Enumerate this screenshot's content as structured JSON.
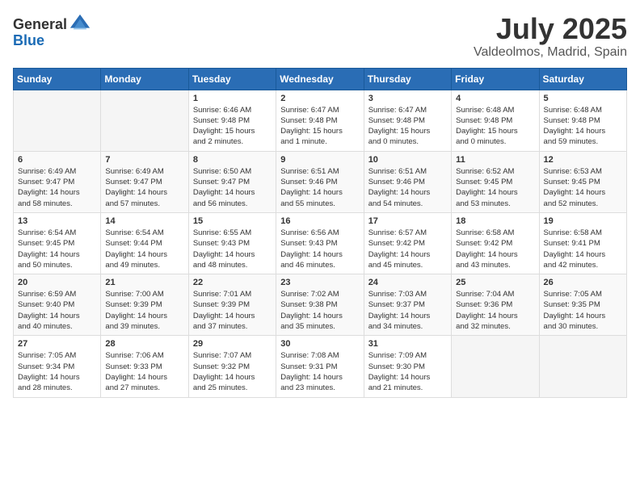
{
  "header": {
    "logo_general": "General",
    "logo_blue": "Blue",
    "month_year": "July 2025",
    "location": "Valdeolmos, Madrid, Spain"
  },
  "calendar": {
    "days_of_week": [
      "Sunday",
      "Monday",
      "Tuesday",
      "Wednesday",
      "Thursday",
      "Friday",
      "Saturday"
    ],
    "weeks": [
      [
        {
          "day": "",
          "info": ""
        },
        {
          "day": "",
          "info": ""
        },
        {
          "day": "1",
          "info": "Sunrise: 6:46 AM\nSunset: 9:48 PM\nDaylight: 15 hours\nand 2 minutes."
        },
        {
          "day": "2",
          "info": "Sunrise: 6:47 AM\nSunset: 9:48 PM\nDaylight: 15 hours\nand 1 minute."
        },
        {
          "day": "3",
          "info": "Sunrise: 6:47 AM\nSunset: 9:48 PM\nDaylight: 15 hours\nand 0 minutes."
        },
        {
          "day": "4",
          "info": "Sunrise: 6:48 AM\nSunset: 9:48 PM\nDaylight: 15 hours\nand 0 minutes."
        },
        {
          "day": "5",
          "info": "Sunrise: 6:48 AM\nSunset: 9:48 PM\nDaylight: 14 hours\nand 59 minutes."
        }
      ],
      [
        {
          "day": "6",
          "info": "Sunrise: 6:49 AM\nSunset: 9:47 PM\nDaylight: 14 hours\nand 58 minutes."
        },
        {
          "day": "7",
          "info": "Sunrise: 6:49 AM\nSunset: 9:47 PM\nDaylight: 14 hours\nand 57 minutes."
        },
        {
          "day": "8",
          "info": "Sunrise: 6:50 AM\nSunset: 9:47 PM\nDaylight: 14 hours\nand 56 minutes."
        },
        {
          "day": "9",
          "info": "Sunrise: 6:51 AM\nSunset: 9:46 PM\nDaylight: 14 hours\nand 55 minutes."
        },
        {
          "day": "10",
          "info": "Sunrise: 6:51 AM\nSunset: 9:46 PM\nDaylight: 14 hours\nand 54 minutes."
        },
        {
          "day": "11",
          "info": "Sunrise: 6:52 AM\nSunset: 9:45 PM\nDaylight: 14 hours\nand 53 minutes."
        },
        {
          "day": "12",
          "info": "Sunrise: 6:53 AM\nSunset: 9:45 PM\nDaylight: 14 hours\nand 52 minutes."
        }
      ],
      [
        {
          "day": "13",
          "info": "Sunrise: 6:54 AM\nSunset: 9:45 PM\nDaylight: 14 hours\nand 50 minutes."
        },
        {
          "day": "14",
          "info": "Sunrise: 6:54 AM\nSunset: 9:44 PM\nDaylight: 14 hours\nand 49 minutes."
        },
        {
          "day": "15",
          "info": "Sunrise: 6:55 AM\nSunset: 9:43 PM\nDaylight: 14 hours\nand 48 minutes."
        },
        {
          "day": "16",
          "info": "Sunrise: 6:56 AM\nSunset: 9:43 PM\nDaylight: 14 hours\nand 46 minutes."
        },
        {
          "day": "17",
          "info": "Sunrise: 6:57 AM\nSunset: 9:42 PM\nDaylight: 14 hours\nand 45 minutes."
        },
        {
          "day": "18",
          "info": "Sunrise: 6:58 AM\nSunset: 9:42 PM\nDaylight: 14 hours\nand 43 minutes."
        },
        {
          "day": "19",
          "info": "Sunrise: 6:58 AM\nSunset: 9:41 PM\nDaylight: 14 hours\nand 42 minutes."
        }
      ],
      [
        {
          "day": "20",
          "info": "Sunrise: 6:59 AM\nSunset: 9:40 PM\nDaylight: 14 hours\nand 40 minutes."
        },
        {
          "day": "21",
          "info": "Sunrise: 7:00 AM\nSunset: 9:39 PM\nDaylight: 14 hours\nand 39 minutes."
        },
        {
          "day": "22",
          "info": "Sunrise: 7:01 AM\nSunset: 9:39 PM\nDaylight: 14 hours\nand 37 minutes."
        },
        {
          "day": "23",
          "info": "Sunrise: 7:02 AM\nSunset: 9:38 PM\nDaylight: 14 hours\nand 35 minutes."
        },
        {
          "day": "24",
          "info": "Sunrise: 7:03 AM\nSunset: 9:37 PM\nDaylight: 14 hours\nand 34 minutes."
        },
        {
          "day": "25",
          "info": "Sunrise: 7:04 AM\nSunset: 9:36 PM\nDaylight: 14 hours\nand 32 minutes."
        },
        {
          "day": "26",
          "info": "Sunrise: 7:05 AM\nSunset: 9:35 PM\nDaylight: 14 hours\nand 30 minutes."
        }
      ],
      [
        {
          "day": "27",
          "info": "Sunrise: 7:05 AM\nSunset: 9:34 PM\nDaylight: 14 hours\nand 28 minutes."
        },
        {
          "day": "28",
          "info": "Sunrise: 7:06 AM\nSunset: 9:33 PM\nDaylight: 14 hours\nand 27 minutes."
        },
        {
          "day": "29",
          "info": "Sunrise: 7:07 AM\nSunset: 9:32 PM\nDaylight: 14 hours\nand 25 minutes."
        },
        {
          "day": "30",
          "info": "Sunrise: 7:08 AM\nSunset: 9:31 PM\nDaylight: 14 hours\nand 23 minutes."
        },
        {
          "day": "31",
          "info": "Sunrise: 7:09 AM\nSunset: 9:30 PM\nDaylight: 14 hours\nand 21 minutes."
        },
        {
          "day": "",
          "info": ""
        },
        {
          "day": "",
          "info": ""
        }
      ]
    ]
  }
}
